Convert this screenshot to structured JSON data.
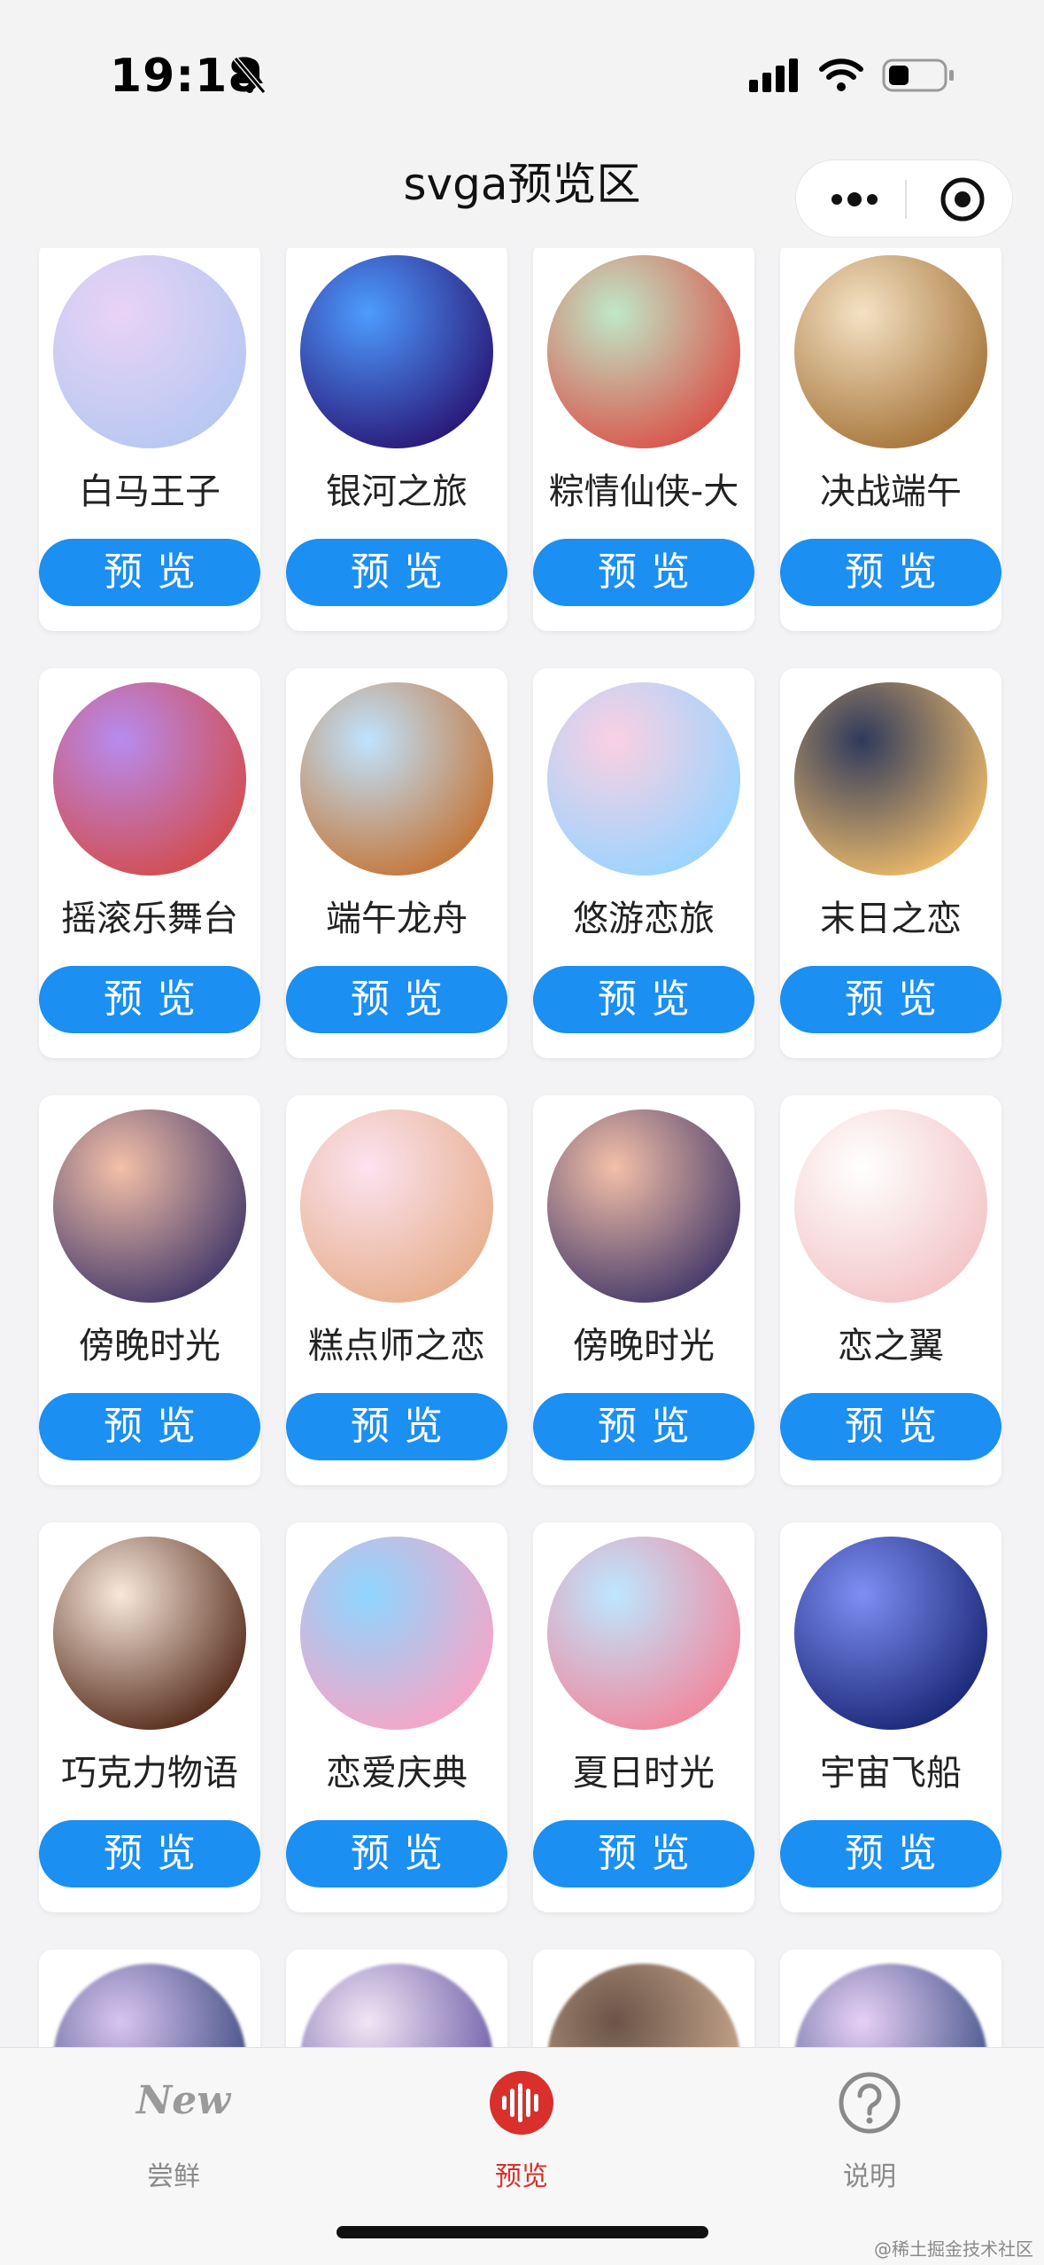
{
  "status_bar": {
    "time": "19:18"
  },
  "nav": {
    "title": "svga预览区"
  },
  "cards": [
    {
      "title": "白马王子",
      "button": "预览",
      "c1": "#e9d3f5",
      "c2": "#b8c8f2"
    },
    {
      "title": "银河之旅",
      "button": "预览",
      "c1": "#4d9cff",
      "c2": "#2a1a7a"
    },
    {
      "title": "粽情仙侠-大",
      "button": "预览",
      "c1": "#bfe8c8",
      "c2": "#d9574d"
    },
    {
      "title": "决战端午",
      "button": "预览",
      "c1": "#f4e2c4",
      "c2": "#a8773d"
    },
    {
      "title": "摇滚乐舞台",
      "button": "预览",
      "c1": "#b78bef",
      "c2": "#d24e52"
    },
    {
      "title": "端午龙舟",
      "button": "预览",
      "c1": "#bfe3ff",
      "c2": "#c4783c"
    },
    {
      "title": "悠游恋旅",
      "button": "预览",
      "c1": "#fbd0e2",
      "c2": "#9bd4ff"
    },
    {
      "title": "末日之恋",
      "button": "预览",
      "c1": "#2f3a5c",
      "c2": "#e8b76a"
    },
    {
      "title": "傍晚时光",
      "button": "预览",
      "c1": "#f3c0a8",
      "c2": "#4a3d6c"
    },
    {
      "title": "糕点师之恋",
      "button": "预览",
      "c1": "#fbe3ef",
      "c2": "#e8b090"
    },
    {
      "title": "傍晚时光",
      "button": "预览",
      "c1": "#f3c0a8",
      "c2": "#4a3d6c"
    },
    {
      "title": "恋之翼",
      "button": "预览",
      "c1": "#ffffff",
      "c2": "#f3c6c8"
    },
    {
      "title": "巧克力物语",
      "button": "预览",
      "c1": "#f8e9dc",
      "c2": "#5a3020"
    },
    {
      "title": "恋爱庆典",
      "button": "预览",
      "c1": "#8fd6ff",
      "c2": "#f4a6c8"
    },
    {
      "title": "夏日时光",
      "button": "预览",
      "c1": "#bde7ff",
      "c2": "#f08aa0"
    },
    {
      "title": "宇宙飞船",
      "button": "预览",
      "c1": "#7e8ef3",
      "c2": "#1c2a7a"
    },
    {
      "title": "",
      "button": "",
      "c1": "#d8c4f0",
      "c2": "#3d4a80"
    },
    {
      "title": "",
      "button": "",
      "c1": "#f0e6f5",
      "c2": "#6b5aa6"
    },
    {
      "title": "",
      "button": "",
      "c1": "#6b5448",
      "c2": "#c9a98e"
    },
    {
      "title": "",
      "button": "",
      "c1": "#e7d0f5",
      "c2": "#405088"
    }
  ],
  "tabs": [
    {
      "label": "尝鲜",
      "icon": "new-icon",
      "active": false
    },
    {
      "label": "预览",
      "icon": "soundwave-icon",
      "active": true
    },
    {
      "label": "说明",
      "icon": "help-icon",
      "active": false
    }
  ],
  "tab_new_text": "New",
  "watermark": "@稀土掘金技术社区",
  "colors": {
    "accent": "#1b8ff2",
    "active_tab": "#d9302b"
  }
}
